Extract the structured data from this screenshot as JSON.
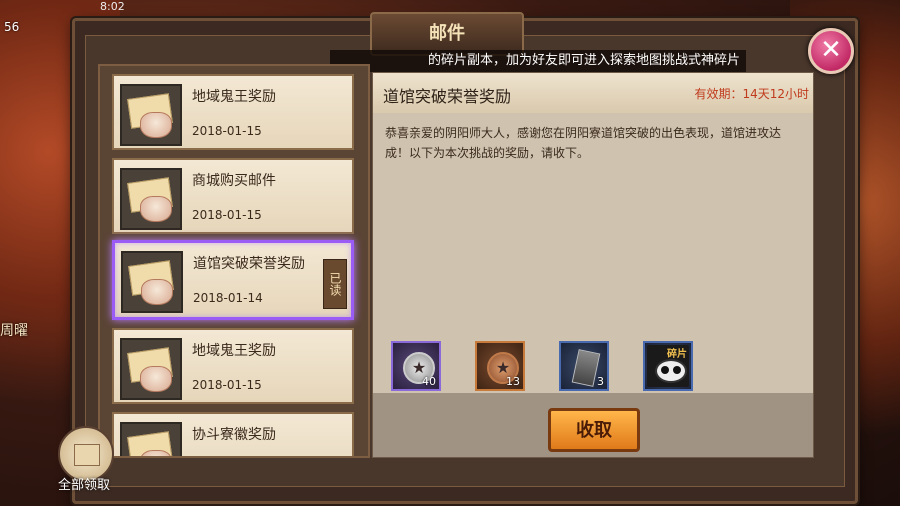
{
  "hud": {
    "level": "56",
    "time": "8:02",
    "side_label": "周曜"
  },
  "window": {
    "title": "邮件",
    "marquee": "的碎片副本，加为好友即可进入探索地图挑战式神碎片"
  },
  "mail_list": [
    {
      "title": "地域鬼王奖励",
      "date": "2018-01-15",
      "read_tag": ""
    },
    {
      "title": "商城购买邮件",
      "date": "2018-01-15",
      "read_tag": ""
    },
    {
      "title": "道馆突破荣誉奖励",
      "date": "2018-01-14",
      "read_tag": "已读"
    },
    {
      "title": "地域鬼王奖励",
      "date": "2018-01-15",
      "read_tag": ""
    },
    {
      "title": "协斗寮徽奖励",
      "date": "",
      "read_tag": ""
    }
  ],
  "detail": {
    "title": "道馆突破荣誉奖励",
    "expiry": "有效期：14天12小时",
    "body": "恭喜亲爱的阴阳师大人，感谢您在阴阳寮道馆突破的出色表现，道馆进攻达成！以下为本次挑战的奖励，请收下。",
    "rewards": [
      {
        "icon": "silver-coin-icon",
        "count": "40"
      },
      {
        "icon": "copper-coin-icon",
        "count": "13"
      },
      {
        "icon": "card-icon",
        "count": "3"
      },
      {
        "icon": "daruma-shard-icon",
        "count": "",
        "label": "碎片"
      }
    ],
    "collect_label": "收取"
  },
  "collect_all_label": "全部领取",
  "colors": {
    "accent_selected": "#9b5cf5",
    "expiry_red": "#c03a1c",
    "collect_orange": "#f0a040"
  }
}
